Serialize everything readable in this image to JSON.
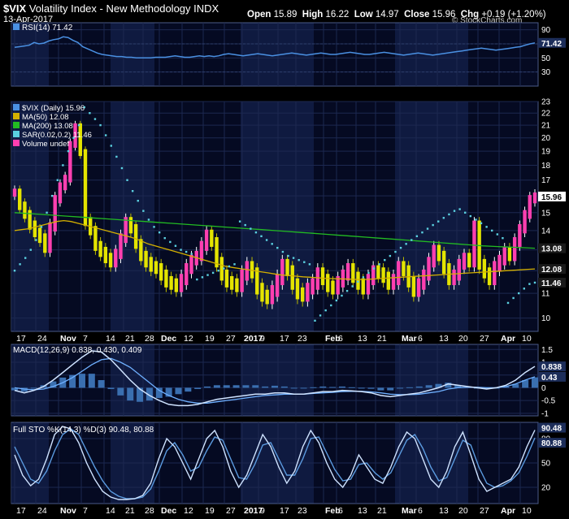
{
  "header": {
    "symbol": "$VIX",
    "name": "Volatility Index - New Methodology",
    "exchange": "INDX",
    "date": "13-Apr-2017",
    "open_label": "Open",
    "open": "15.89",
    "high_label": "High",
    "high": "16.22",
    "low_label": "Low",
    "low": "14.97",
    "close_label": "Close",
    "close": "15.96",
    "chg_label": "Chg",
    "chg": "+0.19 (+1.20%)",
    "credit": "© StockCharts.com"
  },
  "chart_data": [
    {
      "type": "line",
      "panel": "rsi",
      "legend": "RSI(14) 71.42",
      "ylim": [
        10,
        100
      ],
      "ticks": [
        90,
        70,
        50,
        30
      ],
      "last_value": 71.42,
      "series": [
        {
          "name": "RSI(14)",
          "color": "#4a90e2",
          "values": [
            65,
            66,
            67,
            68,
            72,
            70,
            71,
            74,
            76,
            77,
            80,
            79,
            75,
            72,
            66,
            63,
            60,
            57,
            55,
            54,
            53,
            52,
            52,
            51,
            51,
            50,
            50,
            50,
            50,
            51,
            51,
            51,
            52,
            53,
            52,
            51,
            51,
            52,
            53,
            52,
            53,
            52,
            53,
            55,
            56,
            55,
            54,
            53,
            54,
            55,
            56,
            55,
            54,
            53,
            54,
            55,
            56,
            57,
            56,
            55,
            54,
            55,
            56,
            57,
            56,
            55,
            55,
            56,
            57,
            58,
            57,
            56,
            55,
            55,
            56,
            57,
            58,
            57,
            56,
            55,
            54,
            55,
            56,
            57,
            56,
            55,
            54,
            55,
            56,
            57,
            58,
            59,
            60,
            61,
            62,
            63,
            64,
            63,
            62,
            61,
            62,
            63,
            64,
            65,
            66,
            68,
            70,
            71.42
          ]
        }
      ]
    },
    {
      "type": "bar",
      "panel": "price",
      "legend": [
        "$VIX (Daily) 15.96",
        "MA(50) 12.08",
        "MA(200) 13.08",
        "SAR(0.02,0.2) 11.46",
        "Volume undef"
      ],
      "ylim": [
        9.5,
        23
      ],
      "log_scale": true,
      "ticks": [
        23,
        22,
        21,
        20,
        19,
        18,
        17,
        16,
        15,
        14,
        13,
        12,
        11,
        10
      ],
      "value_labels": {
        "close": 15.96,
        "ma200": 13.08,
        "ma50": 12.08,
        "sar": 11.46
      },
      "x_ticks": [
        "17",
        "24",
        "Nov",
        "7",
        "14",
        "21",
        "28",
        "Dec",
        "12",
        "19",
        "27",
        "2017",
        "9",
        "17",
        "23",
        "Feb",
        "6",
        "13",
        "21",
        "Mar",
        "6",
        "13",
        "20",
        "27",
        "Apr",
        "10"
      ],
      "series": [
        {
          "name": "$VIX (Daily)",
          "color": "#e4e400",
          "values": [
            16.2,
            15.4,
            14.9,
            14.3,
            13.9,
            13.6,
            13.1,
            14.2,
            15.8,
            16.6,
            17.1,
            19.5,
            20.9,
            18.9,
            14.5,
            14.0,
            13.2,
            12.9,
            12.6,
            12.4,
            12.8,
            13.6,
            14.5,
            14.1,
            13.3,
            12.7,
            12.4,
            12.2,
            12.1,
            11.8,
            11.5,
            11.4,
            11.3,
            11.6,
            12.1,
            12.5,
            12.7,
            13.2,
            13.8,
            13.4,
            12.4,
            11.8,
            11.5,
            11.4,
            11.3,
            11.8,
            12.2,
            11.9,
            11.2,
            10.9,
            10.8,
            11.1,
            11.6,
            12.3,
            12.0,
            11.4,
            11.0,
            10.9,
            11.2,
            11.4,
            11.9,
            11.6,
            11.3,
            11.2,
            11.5,
            11.8,
            12.1,
            11.7,
            11.4,
            11.2,
            11.6,
            12.0,
            11.9,
            11.7,
            11.4,
            11.6,
            12.2,
            12.0,
            11.5,
            11.1,
            11.4,
            11.8,
            12.4,
            13.0,
            12.7,
            12.1,
            11.6,
            11.8,
            12.3,
            12.6,
            12.4,
            14.3,
            12.3,
            11.9,
            11.6,
            12.2,
            12.5,
            12.9,
            12.7,
            13.4,
            14.1,
            14.9,
            15.8,
            15.96
          ]
        },
        {
          "name": "MA(50)",
          "color": "#d4b000",
          "values": [
            14.0,
            14.05,
            14.1,
            14.2,
            14.3,
            14.4,
            14.5,
            14.55,
            14.5,
            14.4,
            14.3,
            14.2,
            14.1,
            14.0,
            13.9,
            13.8,
            13.7,
            13.6,
            13.45,
            13.3,
            13.2,
            13.1,
            13.0,
            12.9,
            12.8,
            12.7,
            12.6,
            12.5,
            12.4,
            12.3,
            12.2,
            12.15,
            12.1,
            12.05,
            12.0,
            11.95,
            11.9,
            11.85,
            11.8,
            11.78,
            11.75,
            11.72,
            11.7,
            11.68,
            11.65,
            11.64,
            11.63,
            11.62,
            11.61,
            11.6,
            11.6,
            11.62,
            11.64,
            11.66,
            11.68,
            11.7,
            11.72,
            11.74,
            11.76,
            11.78,
            11.8,
            11.82,
            11.84,
            11.86,
            11.88,
            11.9,
            11.92,
            11.94,
            11.96,
            11.98,
            12.0,
            12.02,
            12.04,
            12.06,
            12.08
          ]
        },
        {
          "name": "MA(200)",
          "color": "#22bb22",
          "values": [
            15.0,
            14.95,
            14.9,
            14.85,
            14.8,
            14.75,
            14.7,
            14.65,
            14.6,
            14.55,
            14.5,
            14.45,
            14.4,
            14.35,
            14.3,
            14.25,
            14.2,
            14.15,
            14.1,
            14.05,
            14.0,
            13.95,
            13.9,
            13.85,
            13.8,
            13.75,
            13.7,
            13.65,
            13.6,
            13.55,
            13.5,
            13.45,
            13.4,
            13.35,
            13.3,
            13.25,
            13.2,
            13.17,
            13.14,
            13.11,
            13.08
          ]
        },
        {
          "name": "SAR(0.02,0.2)",
          "color": "#5bd0e0",
          "values": [
            12.0,
            12.3,
            12.6,
            13.0,
            13.5,
            14.2,
            15.0,
            16.0,
            17.0,
            18.0,
            19.0,
            20.0,
            21.0,
            22.5,
            22.0,
            21.5,
            21.0,
            20.2,
            19.4,
            18.6,
            17.8,
            17.0,
            16.3,
            15.7,
            15.1,
            14.6,
            14.2,
            13.9,
            13.6,
            13.4,
            13.2,
            13.0,
            12.9,
            12.8,
            11.6,
            11.7,
            11.8,
            11.9,
            12.0,
            12.1,
            12.2,
            12.3,
            14.5,
            14.3,
            14.1,
            13.9,
            13.7,
            13.5,
            13.3,
            13.1,
            12.9,
            12.7,
            12.6,
            12.5,
            12.4,
            12.3,
            9.9,
            10.1,
            10.3,
            10.5,
            10.7,
            10.9,
            11.1,
            11.3,
            11.5,
            11.7,
            11.9,
            12.1,
            12.3,
            12.5,
            12.7,
            12.9,
            13.1,
            13.3,
            13.5,
            13.7,
            13.9,
            14.1,
            14.3,
            14.5,
            14.7,
            14.9,
            15.1,
            15.2,
            15.0,
            14.8,
            14.6,
            14.4,
            14.2,
            14.0,
            13.8,
            13.6,
            10.6,
            10.8,
            11.0,
            11.2,
            11.4,
            11.46
          ]
        }
      ]
    },
    {
      "type": "line",
      "panel": "macd",
      "legend": "MACD(12,26,9) 0.838, 0.430, 0.409",
      "ylim": [
        -1.1,
        1.7
      ],
      "ticks": [
        1.5,
        1.0,
        0.5,
        0.0,
        -0.5,
        -1.0
      ],
      "value_labels": [
        0.838,
        0.43
      ],
      "series": [
        {
          "name": "MACD(12,26,9)",
          "color": "#cfe3ff",
          "values": [
            -0.1,
            -0.2,
            -0.1,
            0.05,
            0.3,
            0.6,
            0.9,
            1.2,
            1.45,
            1.4,
            1.1,
            0.7,
            0.3,
            -0.05,
            -0.3,
            -0.5,
            -0.65,
            -0.7,
            -0.7,
            -0.65,
            -0.55,
            -0.45,
            -0.4,
            -0.35,
            -0.3,
            -0.25,
            -0.25,
            -0.2,
            -0.2,
            -0.25,
            -0.25,
            -0.2,
            -0.15,
            -0.15,
            -0.1,
            -0.12,
            -0.15,
            -0.2,
            -0.3,
            -0.35,
            -0.3,
            -0.25,
            -0.2,
            -0.1,
            0.0,
            0.15,
            0.1,
            0.05,
            0.0,
            -0.05,
            0.0,
            0.1,
            0.3,
            0.6,
            0.838
          ]
        },
        {
          "name": "Signal",
          "color": "#6fb0ff",
          "values": [
            0.0,
            -0.05,
            -0.08,
            -0.05,
            0.05,
            0.2,
            0.4,
            0.65,
            0.9,
            1.1,
            1.15,
            1.0,
            0.8,
            0.5,
            0.2,
            -0.1,
            -0.3,
            -0.45,
            -0.55,
            -0.6,
            -0.6,
            -0.55,
            -0.5,
            -0.45,
            -0.4,
            -0.35,
            -0.3,
            -0.28,
            -0.25,
            -0.25,
            -0.25,
            -0.22,
            -0.2,
            -0.18,
            -0.15,
            -0.14,
            -0.14,
            -0.16,
            -0.2,
            -0.25,
            -0.27,
            -0.27,
            -0.25,
            -0.2,
            -0.15,
            -0.05,
            0.0,
            0.02,
            0.02,
            0.0,
            0.0,
            0.05,
            0.15,
            0.3,
            0.43
          ]
        },
        {
          "name": "Histogram",
          "color": "#3a6fb0",
          "values": [
            -0.1,
            -0.15,
            -0.02,
            0.1,
            0.25,
            0.4,
            0.5,
            0.55,
            0.55,
            0.3,
            -0.05,
            -0.3,
            -0.5,
            -0.55,
            -0.5,
            -0.4,
            -0.35,
            -0.25,
            -0.15,
            -0.05,
            0.05,
            0.1,
            0.1,
            0.1,
            0.1,
            0.1,
            0.05,
            0.08,
            0.05,
            0.0,
            0.0,
            0.02,
            0.05,
            0.03,
            0.05,
            0.02,
            -0.01,
            -0.04,
            -0.1,
            -0.1,
            -0.03,
            0.02,
            0.05,
            0.1,
            0.15,
            0.2,
            0.1,
            0.03,
            -0.02,
            -0.05,
            0.0,
            0.05,
            0.15,
            0.3,
            0.409
          ]
        }
      ]
    },
    {
      "type": "line",
      "panel": "sto",
      "legend": "Full STO %K(14,3) %D(3) 90.48, 80.88",
      "ylim": [
        0,
        100
      ],
      "ticks": [
        80,
        50,
        20
      ],
      "value_labels": [
        90.48,
        80.88
      ],
      "x_ticks": [
        "17",
        "24",
        "Nov",
        "7",
        "14",
        "21",
        "28",
        "Dec",
        "12",
        "19",
        "27",
        "2017",
        "9",
        "17",
        "23",
        "Feb",
        "6",
        "13",
        "21",
        "Mar",
        "6",
        "13",
        "20",
        "27",
        "Apr",
        "10"
      ],
      "series": [
        {
          "name": "%K(14,3)",
          "color": "#cfe3ff",
          "values": [
            60,
            35,
            22,
            30,
            55,
            85,
            95,
            92,
            75,
            50,
            30,
            15,
            8,
            5,
            5,
            6,
            10,
            25,
            55,
            80,
            70,
            50,
            30,
            55,
            80,
            90,
            70,
            40,
            20,
            35,
            60,
            85,
            70,
            45,
            25,
            40,
            70,
            90,
            75,
            50,
            30,
            20,
            35,
            60,
            45,
            30,
            25,
            45,
            70,
            88,
            80,
            55,
            30,
            20,
            40,
            70,
            88,
            60,
            30,
            15,
            20,
            25,
            30,
            45,
            70,
            90.48
          ]
        },
        {
          "name": "%D(3)",
          "color": "#5b9be0",
          "values": [
            70,
            50,
            30,
            25,
            40,
            65,
            85,
            92,
            85,
            65,
            45,
            28,
            15,
            9,
            6,
            6,
            8,
            18,
            40,
            65,
            75,
            60,
            40,
            45,
            65,
            82,
            78,
            55,
            32,
            30,
            48,
            72,
            75,
            55,
            35,
            35,
            55,
            80,
            82,
            62,
            42,
            28,
            30,
            48,
            50,
            38,
            30,
            38,
            58,
            78,
            85,
            68,
            45,
            28,
            32,
            55,
            78,
            72,
            45,
            25,
            20,
            22,
            28,
            38,
            58,
            80.88
          ]
        }
      ]
    }
  ]
}
